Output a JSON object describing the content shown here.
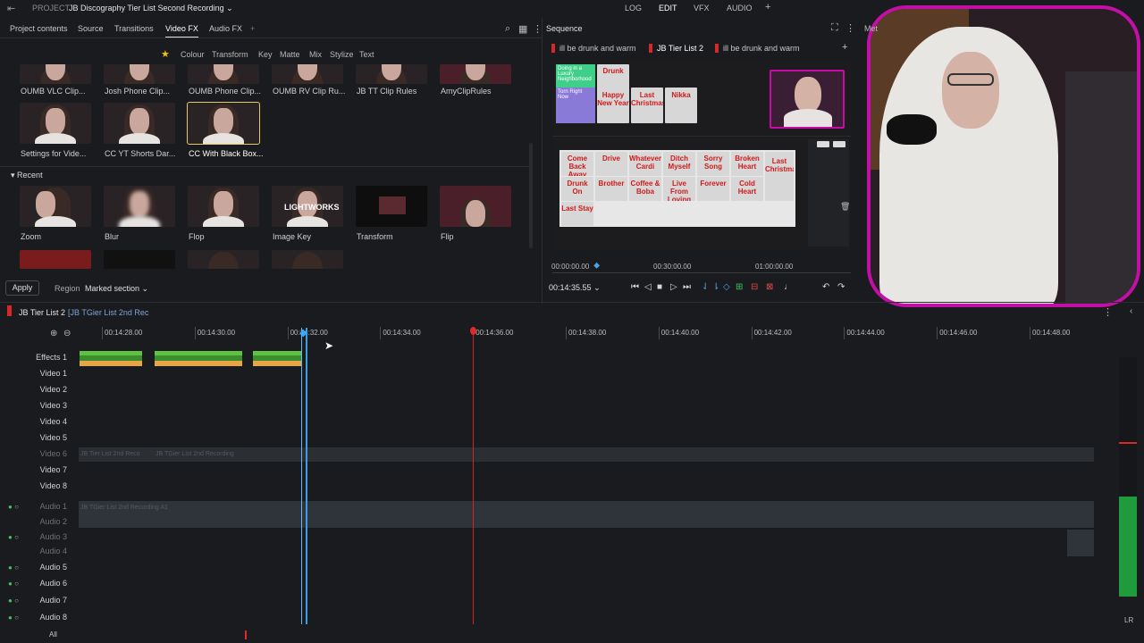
{
  "topbar": {
    "project_label": "PROJECT",
    "project_name": "JB Discography Tier List Second Recording",
    "menus": [
      "LOG",
      "EDIT",
      "VFX",
      "AUDIO",
      "+"
    ]
  },
  "library": {
    "tabs": [
      "Project contents",
      "Source",
      "Transitions",
      "Video FX",
      "Audio FX",
      "+"
    ],
    "fx_categories": [
      "Colour",
      "Transform",
      "Key",
      "Matte",
      "Mix",
      "Stylize",
      "Text"
    ],
    "presets_row1": [
      "OUMB VLC Clip...",
      "Josh Phone Clip...",
      "OUMB Phone Clip...",
      "OUMB RV Clip Ru...",
      "JB TT Clip Rules",
      "AmyClipRules"
    ],
    "presets_row2": [
      "Settings for Vide...",
      "CC YT Shorts Dar...",
      "CC With Black Box..."
    ],
    "recent_heading": "Recent",
    "recent_items": [
      "Zoom",
      "Blur",
      "Flop",
      "Image Key",
      "Transform",
      "Flip"
    ],
    "lightworks_text": "LIGHTWORKS",
    "apply_label": "Apply",
    "region_label": "Region",
    "region_value": "Marked section"
  },
  "sequence": {
    "title": "Sequence",
    "tabs": [
      "ill be drunk and warm",
      "JB Tier List 2",
      "ill be drunk and warm"
    ],
    "timecodes": [
      "00:00:00.00",
      "00:30:00.00",
      "01:00:00.00"
    ],
    "current_tc": "00:14:35.55",
    "meme_top": [
      "Drunk",
      "Happy New Year",
      "Last Christmas",
      "Nikka"
    ],
    "meme_bottom": [
      "Come Back Away",
      "Drive",
      "Whatever Cardi",
      "Ditch Myself",
      "Sorry Song",
      "Broken Heart",
      "Drunk On",
      "Brother",
      "Coffee & Boba",
      "Live From Loving",
      "Forever",
      "Cold Heart",
      "Last Stay",
      "Last Christmas"
    ],
    "tier_labels": [
      "Doing in a Luxury Neighborhood",
      "Torn Right Now"
    ],
    "progress_marker": 0.15
  },
  "camera": {
    "meta_label": "Met"
  },
  "timeline": {
    "title": "JB Tier List 2",
    "subtitle": "[JB TGier List 2nd Rec",
    "ruler": [
      "00:14:28.00",
      "00:14:30.00",
      "00:14:32.00",
      "00:14:34.00",
      "00:14:36.00",
      "00:14:38.00",
      "00:14:40.00",
      "00:14:42.00",
      "00:14:44.00",
      "00:14:46.00",
      "00:14:48.00"
    ],
    "video_tracks": [
      "Effects 1",
      "Video 1",
      "Video 2",
      "Video 3",
      "Video 4",
      "Video 5",
      "Video 6",
      "Video 7",
      "Video 8"
    ],
    "audio_tracks": [
      "Audio 1",
      "Audio 2",
      "Audio 3",
      "Audio 4",
      "Audio 5",
      "Audio 6",
      "Audio 7",
      "Audio 8"
    ],
    "band_text_video": "JB Tier List 2nd Reco",
    "band_text_video2": "JB TGier List 2nd Recording",
    "band_text_audio": "JB TGier List 2nd Recording A1",
    "all_label": "All",
    "lr_label": "LR"
  },
  "colors": {
    "accent_blue": "#3a9fe0",
    "playhead_red": "#d82020",
    "cam_border": "#c20fa6",
    "clip_green": "#5fc243",
    "clip_orange": "#e7a646"
  }
}
